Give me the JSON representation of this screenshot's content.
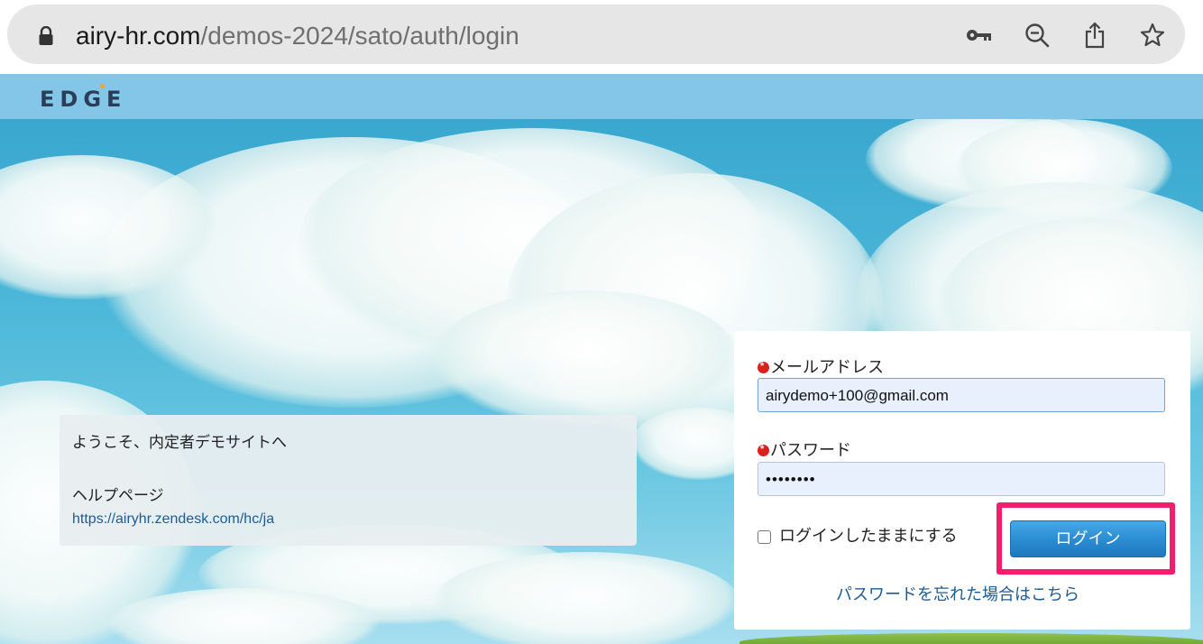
{
  "browser": {
    "url_host": "airy-hr.com",
    "url_path": "/demos-2024/sato/auth/login",
    "icons": [
      "lock-icon",
      "key-icon",
      "zoom-out-icon",
      "share-icon",
      "star-icon"
    ]
  },
  "header": {
    "logo": "EDGE",
    "background_color": "#84c6e8"
  },
  "welcome": {
    "message": "ようこそ、内定者デモサイトへ",
    "help_label": "ヘルプページ",
    "help_link": "https://airyhr.zendesk.com/hc/ja"
  },
  "login": {
    "email_label": "メールアドレス",
    "email_value": "airydemo+100@gmail.com",
    "password_label": "パスワード",
    "password_value": "••••••••",
    "remember_label": "ログインしたままにする",
    "remember_checked": false,
    "login_button": "ログイン",
    "forgot_link": "パスワードを忘れた場合はこちら"
  },
  "colors": {
    "accent_button": "#2a8bd1",
    "highlight_border": "#f21d6c",
    "required_marker": "#d9211d",
    "link": "#1c5b93"
  }
}
